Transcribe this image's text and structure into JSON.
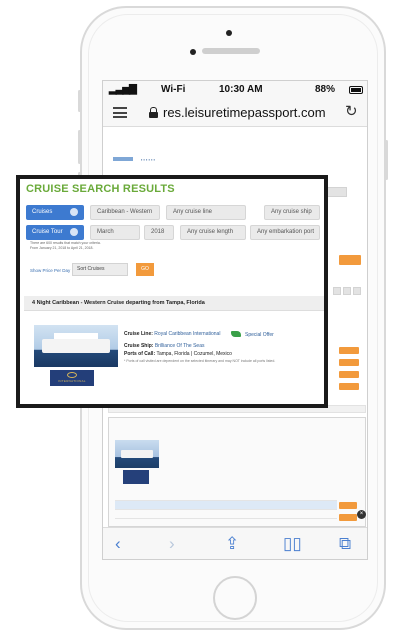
{
  "status_bar": {
    "carrier": "Wi-Fi",
    "time": "10:30 AM",
    "battery": "88%"
  },
  "browser": {
    "url": "res.leisuretimepassport.com"
  },
  "zoom_panel": {
    "title": "CRUISE SEARCH RESULTS",
    "filters_row1": {
      "type_label": "Cruises",
      "destination": "Caribbean - Western",
      "line": "Any cruise line",
      "ship": "Any cruise ship"
    },
    "filters_row2": {
      "type_label": "Cruise Tour",
      "month": "March",
      "year": "2018",
      "length": "Any cruise length",
      "port": "Any embarkation port"
    },
    "result_count": "There are 600 results that match your criteria.",
    "date_range": "From January 21, 2018 to April 21, 2018.",
    "sort_label": "Show Price Per Day",
    "sort_value": "Sort Cruises",
    "go_label": "GO",
    "result_header": "4 Night Caribbean - Western Cruise departing from Tampa, Florida",
    "cruise_line_label": "Cruise Line:",
    "cruise_line_value": "Royal Caribbean International",
    "special_offer": "Special Offer",
    "ship_label": "Cruise Ship:",
    "ship_value": "Brilliance Of The Seas",
    "ports_label": "Ports of Call:",
    "ports_value": "Tampa, Florida | Cozumel, Mexico",
    "ports_note": "* Ports of call visited are dependent on the selected itinerary and may NOT include all ports listed.",
    "logo_text": "INTERNATIONAL"
  }
}
